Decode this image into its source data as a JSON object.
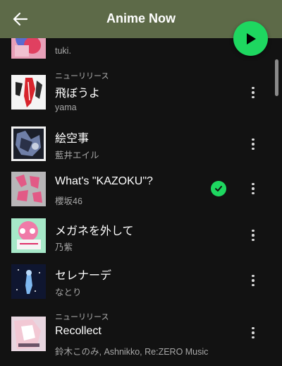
{
  "header": {
    "title": "Anime Now",
    "background": "#5d6a48",
    "back_icon": "arrow-left-icon",
    "play_icon": "play-icon",
    "play_color": "#1ed760"
  },
  "tracks": [
    {
      "title": "",
      "artist": "tuki.",
      "badge": "",
      "saved": false
    },
    {
      "title": "飛ぼうよ",
      "artist": "yama",
      "badge": "ニューリリース",
      "saved": false
    },
    {
      "title": "絵空事",
      "artist": "藍井エイル",
      "badge": "",
      "saved": false
    },
    {
      "title": "What's \"KAZOKU\"?",
      "artist": "櫻坂46",
      "badge": "",
      "saved": true
    },
    {
      "title": "メガネを外して",
      "artist": "乃紫",
      "badge": "",
      "saved": false
    },
    {
      "title": "セレナーデ",
      "artist": "なとり",
      "badge": "",
      "saved": false
    },
    {
      "title": "Recollect",
      "artist": "鈴木このみ, Ashnikko, Re:ZERO Music",
      "badge": "ニューリリース",
      "saved": false
    }
  ],
  "icons": {
    "more": "more-vertical-icon",
    "saved": "check-circle-icon"
  },
  "colors": {
    "accent": "#1ed760",
    "background": "#121212",
    "secondary_text": "#a7a7a7"
  }
}
